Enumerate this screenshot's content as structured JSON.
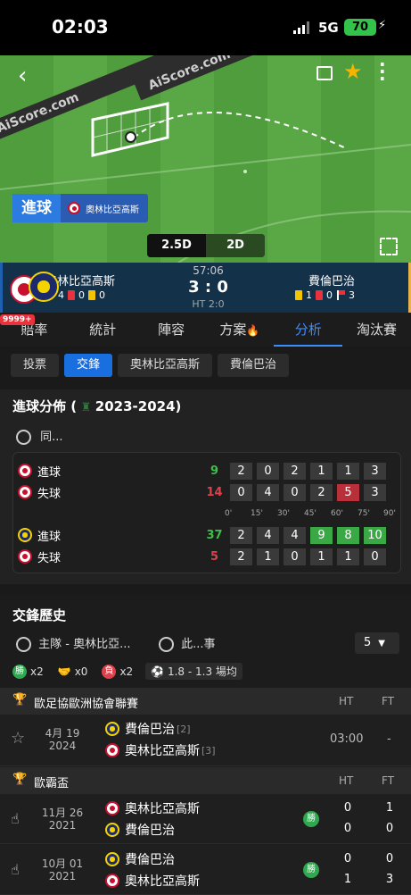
{
  "status_bar": {
    "time": "02:03",
    "network": "5G",
    "battery": "70"
  },
  "pitch": {
    "banner_text": "AiScore.com",
    "event_label": "進球",
    "event_team": "奧林比亞高斯",
    "view_modes": [
      "2.5D",
      "2D"
    ],
    "active_view": "2.5D"
  },
  "match": {
    "home_team": "奧林比亞高斯",
    "away_team": "費倫巴治",
    "clock": "57:06",
    "score": "3 : 0",
    "half_time": "HT 2:0",
    "home_stats": {
      "corners": "4",
      "red": "0",
      "yellow": "0"
    },
    "away_stats": {
      "yellow": "1",
      "red": "0",
      "corners": "3"
    }
  },
  "tabs": {
    "badge": "9999+",
    "items": [
      "賠率",
      "統計",
      "陣容",
      "方案",
      "分析",
      "淘汰賽"
    ],
    "active": "分析"
  },
  "subtabs": {
    "items": [
      "投票",
      "交鋒",
      "奧林比亞高斯",
      "費倫巴治"
    ],
    "active": "交鋒"
  },
  "goal_distribution": {
    "title": "進球分佈 (",
    "season": "2023-2024)",
    "filter_label": "同...",
    "time_ticks": [
      "0'",
      "15'",
      "30'",
      "45'",
      "60'",
      "75'",
      "90'"
    ],
    "rows": [
      {
        "label": "進球",
        "total": "9",
        "values": [
          "2",
          "0",
          "2",
          "1",
          "1",
          "3"
        ],
        "total_color": "#3fbf4a"
      },
      {
        "label": "失球",
        "total": "14",
        "values": [
          "0",
          "4",
          "0",
          "2",
          "5",
          "3"
        ],
        "total_color": "#e0404a"
      },
      {
        "label": "進球",
        "total": "37",
        "values": [
          "2",
          "4",
          "4",
          "9",
          "8",
          "10"
        ],
        "total_color": "#3fbf4a"
      },
      {
        "label": "失球",
        "total": "5",
        "values": [
          "2",
          "1",
          "0",
          "1",
          "1",
          "0"
        ],
        "total_color": "#e0404a"
      }
    ]
  },
  "h2h": {
    "title": "交鋒歷史",
    "filter_home": "主隊 - 奧林比亞...",
    "filter_same": "此...事",
    "count": "5",
    "summary": {
      "win": "x2",
      "draw": "x0",
      "loss": "x2",
      "win_label": "勝",
      "loss_label": "負",
      "goals": "1.8 - 1.3 場均"
    },
    "col_ht": "HT",
    "col_ft": "FT",
    "competitions": [
      {
        "name": "歐足協歐洲協會聯賽",
        "matches": [
          {
            "date": "4月 19",
            "year": "2024",
            "team1": "費倫巴治",
            "team1_rank": "[2]",
            "team2": "奧林比亞高斯",
            "team2_rank": "[3]",
            "time": "03:00",
            "ft": "-"
          }
        ]
      },
      {
        "name": "歐霸盃",
        "matches": [
          {
            "date": "11月 26",
            "year": "2021",
            "team1": "奧林比亞高斯",
            "team2": "費倫巴治",
            "result": "勝",
            "ht1": "0",
            "ht2": "0",
            "ft1": "1",
            "ft2": "0"
          },
          {
            "date": "10月 01",
            "year": "2021",
            "team1": "費倫巴治",
            "team2": "奧林比亞高斯",
            "result": "勝",
            "ht1": "0",
            "ht2": "1",
            "ft1": "0",
            "ft2": "3"
          }
        ]
      }
    ]
  }
}
